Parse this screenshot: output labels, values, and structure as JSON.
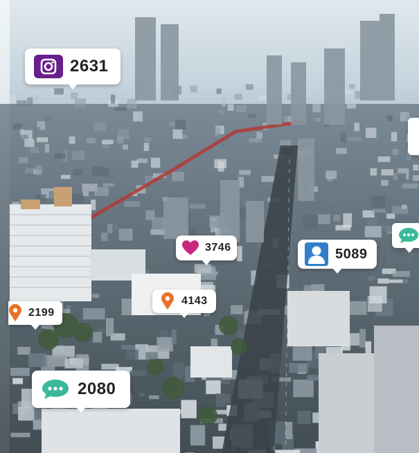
{
  "scene": {
    "subject": "aerial-city-view",
    "sky_color": "#cfdbe3",
    "haze_color": "#a9bccb",
    "building_palette": [
      "#8e9aa4",
      "#6e7c88",
      "#b9c3cb",
      "#d8dee2",
      "#5c6a74",
      "#9aa5ad"
    ]
  },
  "badges": [
    {
      "icon": "camera-icon",
      "value": "2631",
      "icon_color": "#6a1f8c"
    },
    {
      "icon": "heart-icon",
      "value": "3746",
      "icon_color": "#c8287e"
    },
    {
      "icon": "person-icon",
      "value": "5089",
      "icon_color": "#2f80c8"
    },
    {
      "icon": "location-pin-icon",
      "value": "2199",
      "icon_color": "#e8722a"
    },
    {
      "icon": "location-pin-icon",
      "value": "4143",
      "icon_color": "#e8722a"
    },
    {
      "icon": "chat-bubble-icon",
      "value": "2080",
      "icon_color": "#3bb89a"
    },
    {
      "icon": "chat-bubble-icon",
      "value": "",
      "icon_color": "#3bb89a"
    }
  ]
}
